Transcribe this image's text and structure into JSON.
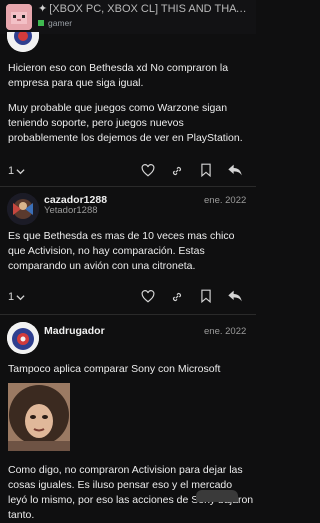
{
  "header": {
    "title": "[XBOX PC, XBOX CL] THIS AND THAT ...",
    "category": "gamer",
    "category_color": "#3fb950"
  },
  "posts": [
    {
      "text_paragraphs": [
        "Hicieron eso con Bethesda xd No compraron la empresa para que siga igual.",
        "Muy probable que juegos como Warzone sigan teniendo soporte, pero juegos nuevos probablemente los dejemos de ver en PlayStation."
      ],
      "reply_count": "1"
    },
    {
      "username": "cazador1288",
      "user_sub": "Yetador1288",
      "date": "ene. 2022",
      "text_paragraphs": [
        "Es que Bethesda es mas de 10 veces mas chico que Activision, no hay comparación. Estas comparando un avión con una citroneta."
      ],
      "reply_count": "1"
    },
    {
      "username": "Madrugador",
      "date": "ene. 2022",
      "text_paragraphs": [
        "Tampoco aplica comparar Sony con Microsoft",
        "Como digo, no compraron Activision para dejar las cosas iguales. Es iluso pensar eso y el mercado leyó lo mismo, por eso las acciones de Sony bajaron tanto."
      ]
    }
  ],
  "icons": {
    "reply_chevron": "chevron-down-icon",
    "like": "heart-icon",
    "link": "link-icon",
    "bookmark": "bookmark-icon",
    "reply": "reply-arrow-icon"
  }
}
